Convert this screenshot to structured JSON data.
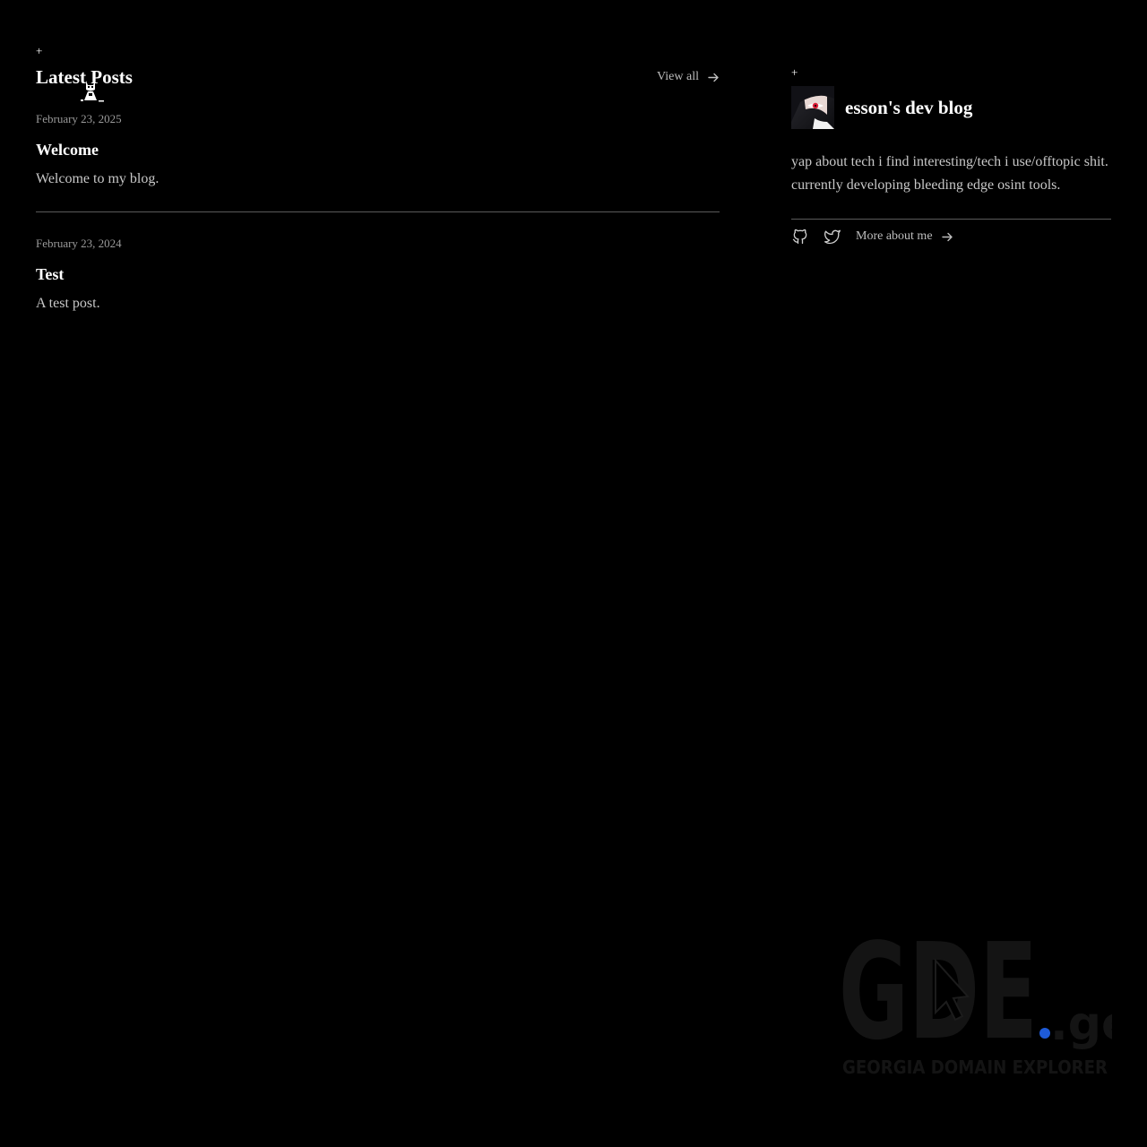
{
  "left": {
    "plus": "+",
    "title": "Latest Posts",
    "view_all": "View all",
    "posts": [
      {
        "date": "February 23, 2025",
        "title": "Welcome",
        "description": "Welcome to my blog."
      },
      {
        "date": "February 23, 2024",
        "title": "Test",
        "description": "A test post."
      }
    ]
  },
  "right": {
    "plus": "+",
    "blog_title": "esson's dev blog",
    "bio": "yap about tech i find interesting/tech i use/offtopic shit. currently developing bleeding edge osint tools.",
    "more_about": "More about me",
    "icons": [
      "github-icon",
      "twitter-icon",
      "arrow-right-icon"
    ]
  },
  "watermark": {
    "logo_text": "GDE",
    "tld": ".ge",
    "tagline": "GEORGIA DOMAIN EXPLORER"
  },
  "colors": {
    "background": "#000000",
    "text": "#ffffff",
    "muted": "#9a9a9a",
    "divider": "#5a5a5a",
    "watermark_dot": "#1e5bd8"
  }
}
